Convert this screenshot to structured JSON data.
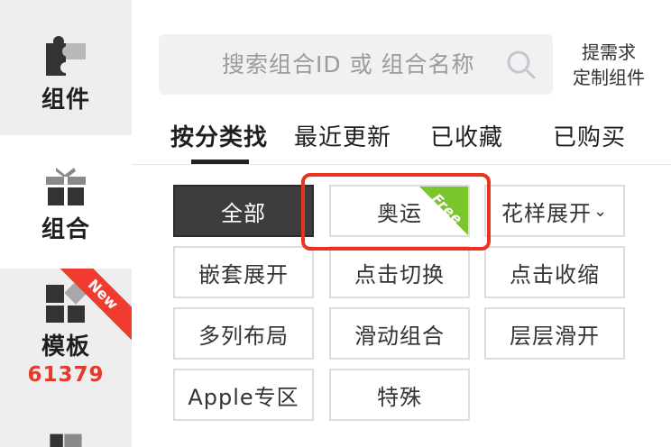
{
  "sidebar": {
    "items": [
      {
        "label": "组件",
        "icon": "puzzle-icon"
      },
      {
        "label": "组合",
        "icon": "gift-icon",
        "active": true
      },
      {
        "label": "模板",
        "icon": "template-grid-icon",
        "badge": "New",
        "count": "61379"
      },
      {
        "label": "",
        "icon": "folder-icon"
      }
    ]
  },
  "search": {
    "placeholder": "搜索组合ID 或 组合名称"
  },
  "request": {
    "line1": "提需求",
    "line2": "定制组件"
  },
  "tabs": [
    {
      "label": "按分类找",
      "active": true
    },
    {
      "label": "最近更新"
    },
    {
      "label": "已收藏"
    },
    {
      "label": "已购买"
    }
  ],
  "filters": [
    {
      "label": "全部",
      "active": true
    },
    {
      "label": "奥运",
      "tag": "Free"
    },
    {
      "label": "花样展开",
      "dropdown": true
    },
    {
      "label": "嵌套展开"
    },
    {
      "label": "点击切换"
    },
    {
      "label": "点击收缩"
    },
    {
      "label": "多列布局"
    },
    {
      "label": "滑动组合"
    },
    {
      "label": "层层滑开"
    },
    {
      "label": "Apple专区"
    },
    {
      "label": "特殊"
    }
  ],
  "colors": {
    "accent_red": "#e8341f",
    "free_green": "#7bc62d",
    "active_chip": "#3d3d3d"
  }
}
